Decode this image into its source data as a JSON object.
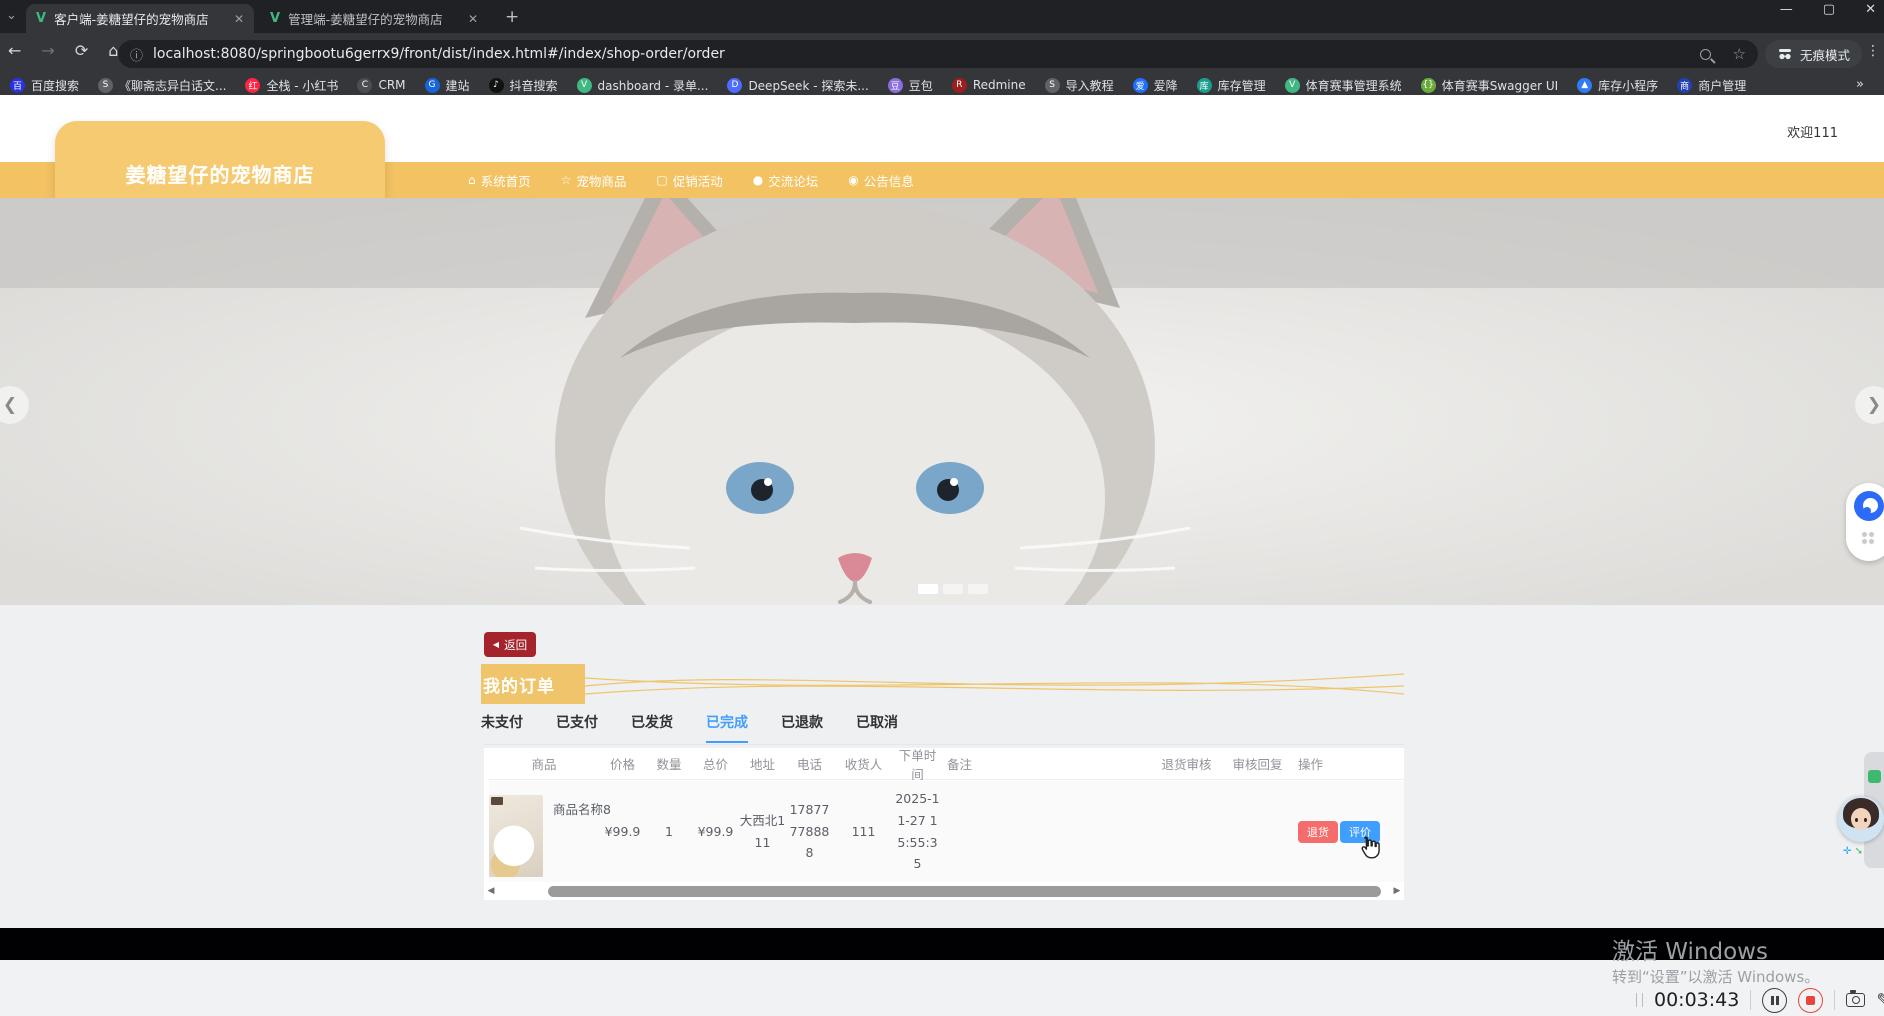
{
  "browser": {
    "tabs": [
      {
        "title": "客户端-姜糖望仔的宠物商店",
        "active": true
      },
      {
        "title": "管理端-姜糖望仔的宠物商店",
        "active": false
      }
    ],
    "url": "localhost:8080/springbootu6gerrx9/front/dist/index.html#/index/shop-order/order",
    "incognito_label": "无痕模式",
    "bookmarks": [
      {
        "label": "百度搜索",
        "glyph": "百",
        "bg": "#2932e1"
      },
      {
        "label": "《聊斋志异白话文...",
        "glyph": "S",
        "bg": "#5f6368"
      },
      {
        "label": "全栈 - 小红书",
        "glyph": "红",
        "bg": "#ff2442"
      },
      {
        "label": "CRM",
        "glyph": "C",
        "bg": "#4a4d51"
      },
      {
        "label": "建站",
        "glyph": "G",
        "bg": "#1766d9"
      },
      {
        "label": "抖音搜索",
        "glyph": "♪",
        "bg": "#111111"
      },
      {
        "label": "dashboard - 录单...",
        "glyph": "V",
        "bg": "#41b883"
      },
      {
        "label": "DeepSeek - 探索未...",
        "glyph": "D",
        "bg": "#4d6bfe"
      },
      {
        "label": "豆包",
        "glyph": "豆",
        "bg": "#8a6ddf"
      },
      {
        "label": "Redmine",
        "glyph": "R",
        "bg": "#9c1f1f"
      },
      {
        "label": "导入教程",
        "glyph": "S",
        "bg": "#5f6368"
      },
      {
        "label": "爱降",
        "glyph": "爱",
        "bg": "#1e6fff"
      },
      {
        "label": "库存管理",
        "glyph": "库",
        "bg": "#1b9e8f"
      },
      {
        "label": "体育赛事管理系统",
        "glyph": "V",
        "bg": "#41b883"
      },
      {
        "label": "体育赛事Swagger UI",
        "glyph": "{}",
        "bg": "#6aab3c"
      },
      {
        "label": "库存小程序",
        "glyph": "▲",
        "bg": "#2f7bf6"
      },
      {
        "label": "商户管理",
        "glyph": "商",
        "bg": "#2440b3"
      }
    ]
  },
  "site": {
    "logo": "姜糖望仔的宠物商店",
    "welcome": "欢迎111",
    "nav": [
      {
        "glyph": "⌂",
        "label": "系统首页"
      },
      {
        "glyph": "☆",
        "label": "宠物商品"
      },
      {
        "glyph": "▢",
        "label": "促销活动"
      },
      {
        "glyph": "●",
        "label": "交流论坛"
      },
      {
        "glyph": "◉",
        "label": "公告信息"
      }
    ],
    "carousel_dots": [
      {
        "active": true
      },
      {
        "active": false
      },
      {
        "active": false
      }
    ]
  },
  "orders": {
    "back_label": "返回",
    "title": "我的订单",
    "tabs": [
      {
        "label": "未支付",
        "active": false
      },
      {
        "label": "已支付",
        "active": false
      },
      {
        "label": "已发货",
        "active": false
      },
      {
        "label": "已完成",
        "active": true
      },
      {
        "label": "已退款",
        "active": false
      },
      {
        "label": "已取消",
        "active": false
      }
    ],
    "columns": [
      "商品",
      "价格",
      "数量",
      "总价",
      "地址",
      "电话",
      "收货人",
      "下单时间",
      "备注",
      "退货审核",
      "审核回复",
      "操作"
    ],
    "row": {
      "name": "商品名称8",
      "price": "¥99.9",
      "quantity": "1",
      "total": "¥99.9",
      "address": "大西北111",
      "phone": "17877778888",
      "receiver": "111",
      "order_time": "2025-11-27 15:55:35",
      "remark": "",
      "return_audit": "",
      "audit_reply": "",
      "actions": [
        {
          "label": "退货",
          "bg": "#f56c6c"
        },
        {
          "label": "评价",
          "bg": "#409eff"
        }
      ]
    }
  },
  "watermark": {
    "line1": "激活 Windows",
    "line2": "转到“设置”以激活 Windows。"
  },
  "recorder": {
    "time": "00:03:43"
  }
}
